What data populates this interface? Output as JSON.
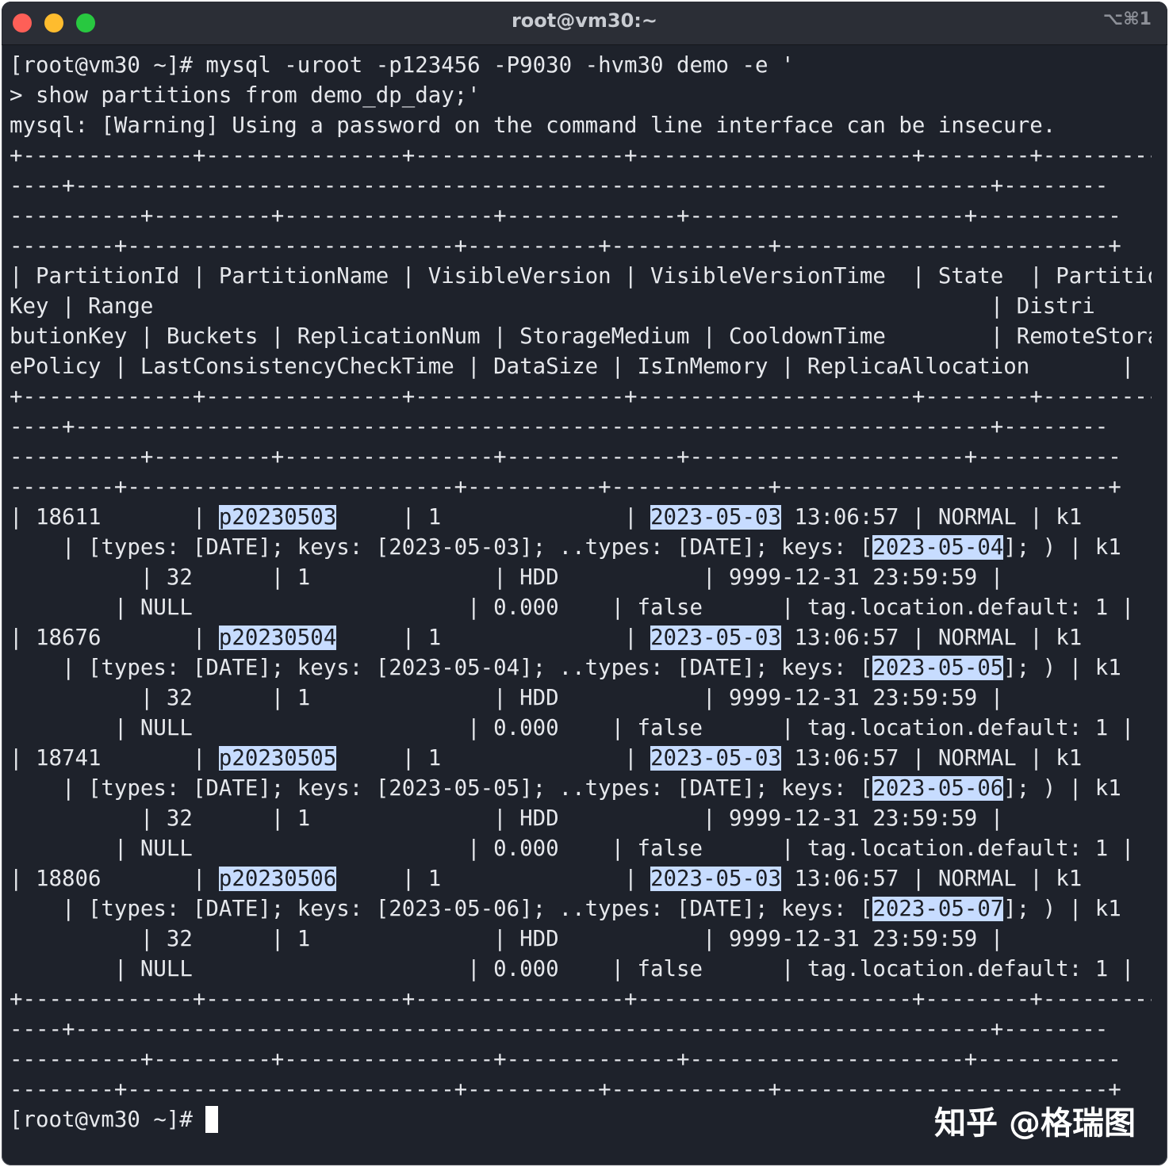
{
  "window": {
    "title": "root@vm30:~",
    "shortcut": "⌥⌘1"
  },
  "terminal": {
    "lines": [
      [
        {
          "t": "[root@vm30 ~]# mysql -uroot -p123456 -P9030 -hvm30 demo -e '"
        }
      ],
      [
        {
          "t": "> show partitions from demo_dp_day;'"
        }
      ],
      [
        {
          "t": "mysql: [Warning] Using a password on the command line interface can be insecure."
        }
      ],
      [
        {
          "t": "+-------------+---------------+----------------+---------------------+--------+----------"
        }
      ],
      [
        {
          "t": "----+----------------------------------------------------------------------+--------"
        }
      ],
      [
        {
          "t": "----------+---------+----------------+-------------+---------------------+-----------"
        }
      ],
      [
        {
          "t": "--------+-------------------------+----------+------------+-------------------------+"
        }
      ],
      [
        {
          "t": "| PartitionId | PartitionName | VisibleVersion | VisibleVersionTime  | State  | Partition"
        }
      ],
      [
        {
          "t": "Key | Range                                                                | Distri"
        }
      ],
      [
        {
          "t": "butionKey | Buckets | ReplicationNum | StorageMedium | CooldownTime        | RemoteStorag"
        }
      ],
      [
        {
          "t": "ePolicy | LastConsistencyCheckTime | DataSize | IsInMemory | ReplicaAllocation       |"
        }
      ],
      [
        {
          "t": "+-------------+---------------+----------------+---------------------+--------+----------"
        }
      ],
      [
        {
          "t": "----+----------------------------------------------------------------------+--------"
        }
      ],
      [
        {
          "t": "----------+---------+----------------+-------------+---------------------+-----------"
        }
      ],
      [
        {
          "t": "--------+-------------------------+----------+------------+-------------------------+"
        }
      ],
      [
        {
          "t": "| 18611       | "
        },
        {
          "t": "p20230503",
          "hl": true
        },
        {
          "t": "     | 1              | "
        },
        {
          "t": "2023-05-03",
          "hl": true
        },
        {
          "t": " 13:06:57 | NORMAL | k1"
        }
      ],
      [
        {
          "t": "    | [types: [DATE]; keys: [2023-05-03]; ..types: [DATE]; keys: ["
        },
        {
          "t": "2023-05-04",
          "hl": true
        },
        {
          "t": "]; ) | k1"
        }
      ],
      [
        {
          "t": "          | 32      | 1              | HDD           | 9999-12-31 23:59:59 |"
        }
      ],
      [
        {
          "t": "        | NULL                     | 0.000    | false      | tag.location.default: 1 |"
        }
      ],
      [
        {
          "t": "| 18676       | "
        },
        {
          "t": "p20230504",
          "hl": true
        },
        {
          "t": "     | 1              | "
        },
        {
          "t": "2023-05-03",
          "hl": true
        },
        {
          "t": " 13:06:57 | NORMAL | k1"
        }
      ],
      [
        {
          "t": "    | [types: [DATE]; keys: [2023-05-04]; ..types: [DATE]; keys: ["
        },
        {
          "t": "2023-05-05",
          "hl": true
        },
        {
          "t": "]; ) | k1"
        }
      ],
      [
        {
          "t": "          | 32      | 1              | HDD           | 9999-12-31 23:59:59 |"
        }
      ],
      [
        {
          "t": "        | NULL                     | 0.000    | false      | tag.location.default: 1 |"
        }
      ],
      [
        {
          "t": "| 18741       | "
        },
        {
          "t": "p20230505",
          "hl": true
        },
        {
          "t": "     | 1              | "
        },
        {
          "t": "2023-05-03",
          "hl": true
        },
        {
          "t": " 13:06:57 | NORMAL | k1"
        }
      ],
      [
        {
          "t": "    | [types: [DATE]; keys: [2023-05-05]; ..types: [DATE]; keys: ["
        },
        {
          "t": "2023-05-06",
          "hl": true
        },
        {
          "t": "]; ) | k1"
        }
      ],
      [
        {
          "t": "          | 32      | 1              | HDD           | 9999-12-31 23:59:59 |"
        }
      ],
      [
        {
          "t": "        | NULL                     | 0.000    | false      | tag.location.default: 1 |"
        }
      ],
      [
        {
          "t": "| 18806       | "
        },
        {
          "t": "p20230506",
          "hl": true
        },
        {
          "t": "     | 1              | "
        },
        {
          "t": "2023-05-03",
          "hl": true
        },
        {
          "t": " 13:06:57 | NORMAL | k1"
        }
      ],
      [
        {
          "t": "    | [types: [DATE]; keys: [2023-05-06]; ..types: [DATE]; keys: ["
        },
        {
          "t": "2023-05-07",
          "hl": true
        },
        {
          "t": "]; ) | k1"
        }
      ],
      [
        {
          "t": "          | 32      | 1              | HDD           | 9999-12-31 23:59:59 |"
        }
      ],
      [
        {
          "t": "        | NULL                     | 0.000    | false      | tag.location.default: 1 |"
        }
      ],
      [
        {
          "t": "+-------------+---------------+----------------+---------------------+--------+----------"
        }
      ],
      [
        {
          "t": "----+----------------------------------------------------------------------+--------"
        }
      ],
      [
        {
          "t": "----------+---------+----------------+-------------+---------------------+-----------"
        }
      ],
      [
        {
          "t": "--------+-------------------------+----------+------------+-------------------------+"
        }
      ]
    ],
    "prompt": "[root@vm30 ~]# "
  },
  "watermark": "知乎 @格瑞图",
  "colors": {
    "background": "#1e222b",
    "titlebar": "#2b2e36",
    "text": "#e6e8ec",
    "highlight": "#c7dcff",
    "close": "#fe5f57",
    "minimize": "#febc2e",
    "maximize": "#28c840"
  }
}
